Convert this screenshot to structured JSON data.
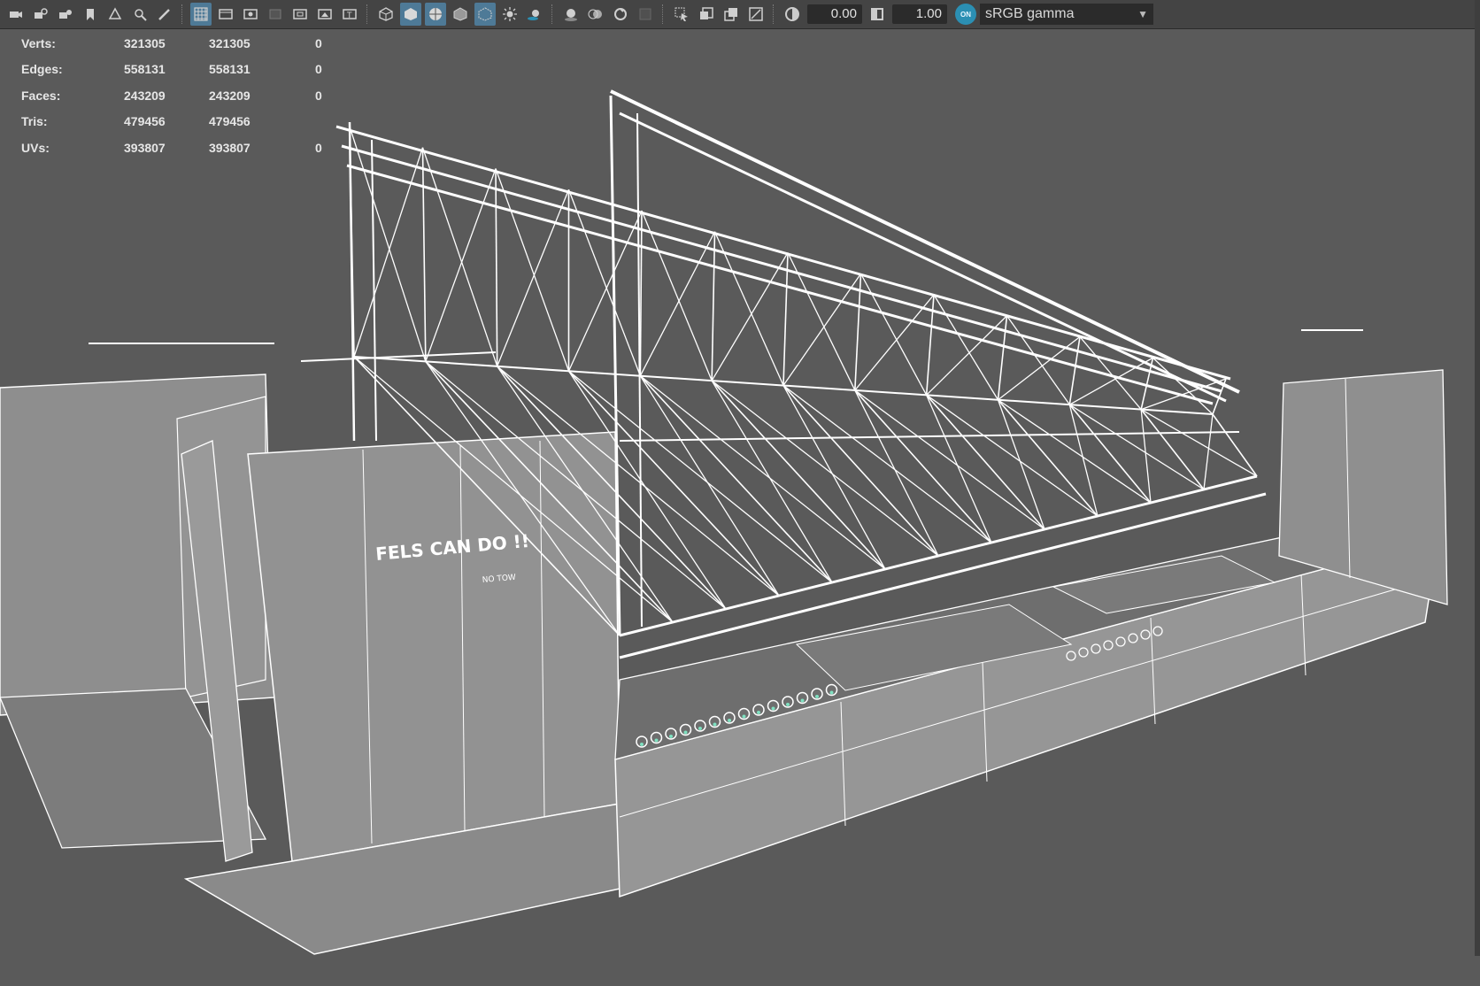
{
  "toolbar": {
    "icons": [
      "camera-select-icon",
      "camera-lock-icon",
      "camera-attributes-icon",
      "bookmark-icon",
      "image-plane-icon",
      "2d-pan-zoom-icon",
      "grease-pencil-icon",
      "grid-icon",
      "film-gate-icon",
      "resolution-gate-icon",
      "gate-mask-icon",
      "field-chart-icon",
      "safe-action-icon",
      "safe-title-icon",
      "wireframe-icon",
      "smooth-shade-icon",
      "wireframe-on-shaded-icon",
      "default-material-icon",
      "xray-icon",
      "lights-icon",
      "shadows-icon",
      "ambient-occlusion-icon",
      "motion-blur-icon",
      "anti-aliasing-icon",
      "depth-of-field-icon",
      "isolate-select-icon",
      "xray-joints-icon",
      "xray-components-icon",
      "texture-icon",
      "exposure-icon",
      "gamma-icon",
      "color-management-icon"
    ],
    "exposure_value": "0.00",
    "gamma_value": "1.00",
    "color_management_on": "ON",
    "view_transform": "sRGB gamma"
  },
  "hud": {
    "rows": [
      {
        "label": "Verts:",
        "v1": "321305",
        "v2": "321305",
        "v3": "0"
      },
      {
        "label": "Edges:",
        "v1": "558131",
        "v2": "558131",
        "v3": "0"
      },
      {
        "label": "Faces:",
        "v1": "243209",
        "v2": "243209",
        "v3": "0"
      },
      {
        "label": "Tris:",
        "v1": "479456",
        "v2": "479456",
        "v3": ""
      },
      {
        "label": "UVs:",
        "v1": "393807",
        "v2": "393807",
        "v3": "0"
      }
    ]
  },
  "model": {
    "hull_text": "FELS CAN DO !!",
    "hull_subtext": "NO TOW"
  },
  "colors": {
    "viewport_bg": "#5a5a5a",
    "toolbar_bg": "#444444",
    "active_button": "#4e7a97",
    "wire": "#ffffff",
    "hull_fill": "#909090",
    "accent_green": "#7fe0c0"
  }
}
